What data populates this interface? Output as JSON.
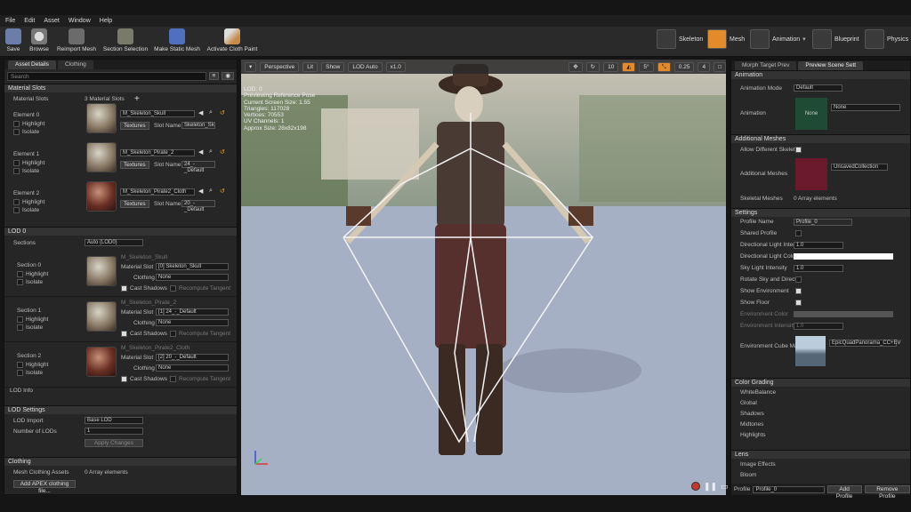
{
  "menu": [
    "File",
    "Edit",
    "Asset",
    "Window",
    "Help"
  ],
  "toolbar": {
    "buttons": [
      "Save",
      "Browse",
      "Reimport Mesh",
      "Section Selection",
      "Make Static Mesh",
      "Activate Cloth Paint"
    ]
  },
  "modes": [
    "Skeleton",
    "Mesh",
    "Animation",
    "Blueprint",
    "Physics"
  ],
  "left": {
    "tabs": [
      "Asset Details",
      "Clothing"
    ],
    "search_placeholder": "Search",
    "material_slots": {
      "header": "Material Slots",
      "label": "Material Slots",
      "count": "3 Material Slots",
      "elements": [
        {
          "name": "Element 0",
          "material": "M_Skeleton_Skull",
          "slot_name": "Skeleton_Sk"
        },
        {
          "name": "Element 1",
          "material": "M_Skeleton_Pirate_2",
          "slot_name": "24_-_Default"
        },
        {
          "name": "Element 2",
          "material": "M_Skeleton_Pirate2_Cloth",
          "slot_name": "20_-_Default"
        }
      ],
      "highlight": "Highlight",
      "isolate": "Isolate",
      "textures": "Textures",
      "slot_label": "Slot Name"
    },
    "lod0": {
      "header": "LOD 0",
      "sections_label": "Sections",
      "sections_value": "Auto (LOD0)",
      "sections": [
        {
          "name": "Section 0",
          "material": "M_Skeleton_Skull",
          "slot": "[0] Skeleton_Skull"
        },
        {
          "name": "Section 1",
          "material": "M_Skeleton_Pirate_2",
          "slot": "[1] 24_-_Default"
        },
        {
          "name": "Section 2",
          "material": "M_Skeleton_Pirate2_Cloth",
          "slot": "[2] 20_-_Default"
        }
      ],
      "material_slot": "Material Slot",
      "clothing": "Clothing",
      "none": "None",
      "cast_shadows": "Cast Shadows",
      "recompute": "Recompute Tangent",
      "lod_info": "LOD Info"
    },
    "lod_settings": {
      "header": "LOD Settings",
      "lod_import": "LOD Import",
      "lod_import_value": "Base LOD",
      "num_lods": "Number of LODs",
      "num_lods_value": "1",
      "apply": "Apply Changes"
    },
    "clothing": {
      "header": "Clothing",
      "assets_label": "Mesh Clothing Assets",
      "assets_value": "0 Array elements",
      "add_button": "Add APEX clothing file..."
    }
  },
  "viewport": {
    "perspective": "Perspective",
    "lit": "Lit",
    "show": "Show",
    "lod_auto": "LOD Auto",
    "speed": "x1.0",
    "right_values": [
      "10",
      "5°",
      "0.25",
      "4"
    ],
    "stats": [
      "LOD: 0",
      "Previewing Reference Pose",
      "Current Screen Size: 1.55",
      "Triangles: 117028",
      "Vertices: 70553",
      "UV Channels: 1",
      "Approx Size: 28x82x198"
    ]
  },
  "right": {
    "tabs": [
      "Morph Target Prev",
      "Preview Scene Sett"
    ],
    "animation": {
      "header": "Animation",
      "mode_label": "Animation Mode",
      "mode_value": "Default",
      "anim_label": "Animation",
      "anim_value": "None",
      "thumb_text": "None"
    },
    "meshes": {
      "header": "Additional Meshes",
      "allow_label": "Allow Different Skelet",
      "add_label": "Additional Meshes",
      "add_value": "UnsavedCollection",
      "skel_label": "Skeletal Meshes",
      "skel_value": "0 Array elements"
    },
    "settings": {
      "header": "Settings",
      "rows": [
        "Profile Name",
        "Shared Profile",
        "Directional Light Inter",
        "Directional Light Colo",
        "Sky Light Intensity",
        "Rotate Sky and Direct",
        "Show Environment",
        "Show Floor",
        "Environment Color",
        "Environment Intensity",
        "Environment Cube Ma"
      ],
      "profile_name": "Profile_0",
      "dir_intensity": "1.0",
      "sky_intensity": "1.0",
      "env_intensity": "1.0",
      "cube_value": "EpicQuadPanorama_CC+EV"
    },
    "color_grading": {
      "header": "Color Grading",
      "items": [
        "WhiteBalance",
        "Global",
        "Shadows",
        "Midtones",
        "Highlights"
      ]
    },
    "lens": {
      "header": "Lens",
      "items": [
        "Image Effects",
        "Bloom"
      ]
    },
    "footer": {
      "profile_label": "Profile",
      "profile_value": "Profile_0",
      "add": "Add Profile",
      "remove": "Remove Profile"
    }
  }
}
